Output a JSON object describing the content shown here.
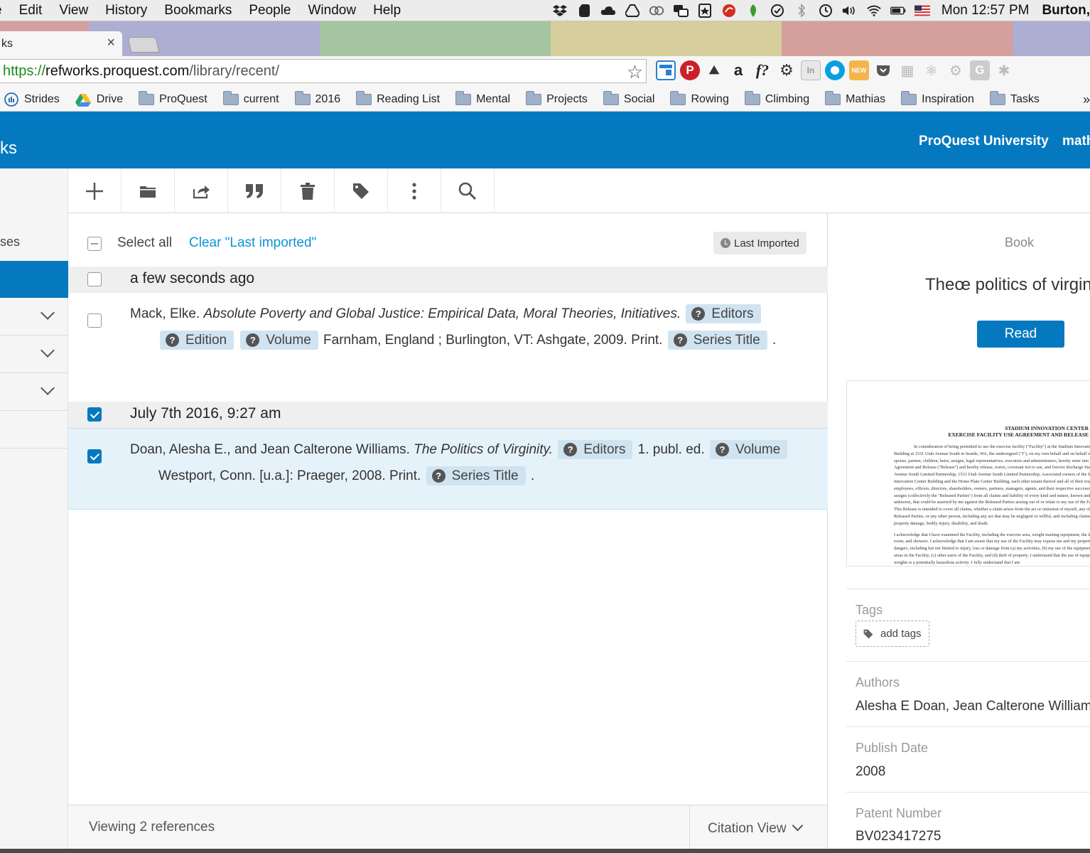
{
  "menubar": {
    "items": [
      "e",
      "Edit",
      "View",
      "History",
      "Bookmarks",
      "People",
      "Window",
      "Help"
    ],
    "clock": "Mon 12:57 PM",
    "user": "Burton,"
  },
  "tab": {
    "title": "ks",
    "close": "×"
  },
  "address": {
    "scheme": "https://",
    "domain": "refworks.proquest.com",
    "path": "/library/recent/"
  },
  "bookmarks": {
    "items": [
      "Strides",
      "Drive",
      "ProQuest",
      "current",
      "2016",
      "Reading List",
      "Mental",
      "Projects",
      "Social",
      "Rowing",
      "Climbing",
      "Mathias",
      "Inspiration",
      "Tasks"
    ],
    "overflow": "»"
  },
  "header": {
    "brand": "ks",
    "org": "ProQuest University",
    "user": "math"
  },
  "sidebar": {
    "label": "ses"
  },
  "list": {
    "select_all": "Select all",
    "clear_link": "Clear \"Last imported\"",
    "sort_label": "Last Imported",
    "groups": [
      {
        "heading": "a few seconds ago",
        "checked": false,
        "refs": [
          {
            "authors": "Mack, Elke.",
            "title": "Absolute Poverty and Global Justice: Empirical Data, Moral Theories, Initiatives.",
            "pill_editors": "Editors",
            "pill_edition": "Edition",
            "pill_volume": "Volume",
            "publisher": "Farnham, England ; Burlington, VT: Ashgate, 2009. Print.",
            "pill_series": "Series Title",
            "end": "."
          }
        ]
      },
      {
        "heading": "July 7th 2016, 9:27 am",
        "checked": true,
        "refs": [
          {
            "authors": "Doan, Alesha E., and Jean Calterone Williams.",
            "title": "The Politics of Virginity.",
            "pill_editors": "Editors",
            "edition_text": "1. publ. ed.",
            "pill_volume": "Volume",
            "publisher": "Westport, Conn. [u.a.]: Praeger, 2008. Print.",
            "pill_series": "Series Title",
            "end": "."
          }
        ]
      }
    ],
    "footer_count": "Viewing 2 references",
    "view_mode": "Citation View"
  },
  "detail": {
    "type": "Book",
    "title": "Theœ politics of virgin",
    "read_label": "Read",
    "doc_preview": {
      "heading1": "STADIUM INNOVATION CENTER",
      "heading2": "EXERCISE FACILITY USE AGREEMENT AND RELEASE",
      "para1": "In consideration of being permitted to use the exercise facility (\"Facility\") at the Stadium Innovation Center Building at 1531 Utah Avenue South in Seattle, WA, the undersigned (\"I\"), on my own behalf and on behalf of my spouse, partner, children, heirs, assigns, legal representatives, executors and administrators, hereby enter into this Agreement and Release (\"Release\") and hereby release, waive, covenant not to sue, and forever discharge Stadium Avenue South Limited Partnership, 1531 Utah Avenue South Limited Partnership, Associated owners of the Stadium Innovation Center Building and the Home Plate Center Building, each other tenant thereof and all of their respective employees, officers, directors, shareholders, owners, partners, managers, agents, and their respective successors and assigns (collectively the \"Released Parties\") from all claims and liability of every kind and nature, known and unknown, that could be asserted by me against the Released Parties arising out of or relate to my use of the Facility. This Release is intended to cover all claims, whether a claim arises from the act or omission of myself, any of the Released Parties, or any other person, including any act that may be negligent or willful, and including claims for property damage, bodily injury, disability, and death.",
      "para2": "I acknowledge that I have examined the Facility, including the exercise area, weight training equipment, the locker room, and showers. I acknowledge that I am aware that my use of the Facility may expose me and my property to dangers, including but not limited to injury, loss or damage from (a) my activities, (b) my use of the equipment and areas in the Facility, (c) other users of the Facility, and (d) theft of property. I understand that the use of equipment and weights is a potentially hazardous activity. I fully understand that I am"
    },
    "tags_label": "Tags",
    "add_tags": "add tags",
    "authors_label": "Authors",
    "authors_value": "Alesha E Doan, Jean Calterone Williams",
    "date_label": "Publish Date",
    "date_value": "2008",
    "patent_label": "Patent Number",
    "patent_value": "BV023417275"
  },
  "colors": {
    "brand_blue": "#0579c0",
    "link_blue": "#0d93d8",
    "selected_row": "#e6f2fa"
  }
}
